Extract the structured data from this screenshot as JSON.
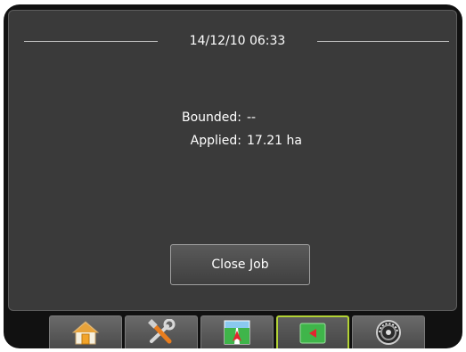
{
  "header": {
    "datetime": "14/12/10 06:33"
  },
  "stats": {
    "bounded_label": "Bounded:",
    "bounded_value": "--",
    "applied_label": "Applied:",
    "applied_value": "17.21 ha"
  },
  "actions": {
    "close_job_label": "Close Job"
  },
  "tabs": [
    {
      "icon": "home-icon",
      "active": false
    },
    {
      "icon": "tools-icon",
      "active": false
    },
    {
      "icon": "guidance-view-icon",
      "active": false
    },
    {
      "icon": "field-map-icon",
      "active": true
    },
    {
      "icon": "gauge-icon",
      "active": false
    }
  ],
  "colors": {
    "active_tab_border": "#b3d335",
    "accent_red": "#e3262e",
    "map_green": "#3fb54a"
  }
}
